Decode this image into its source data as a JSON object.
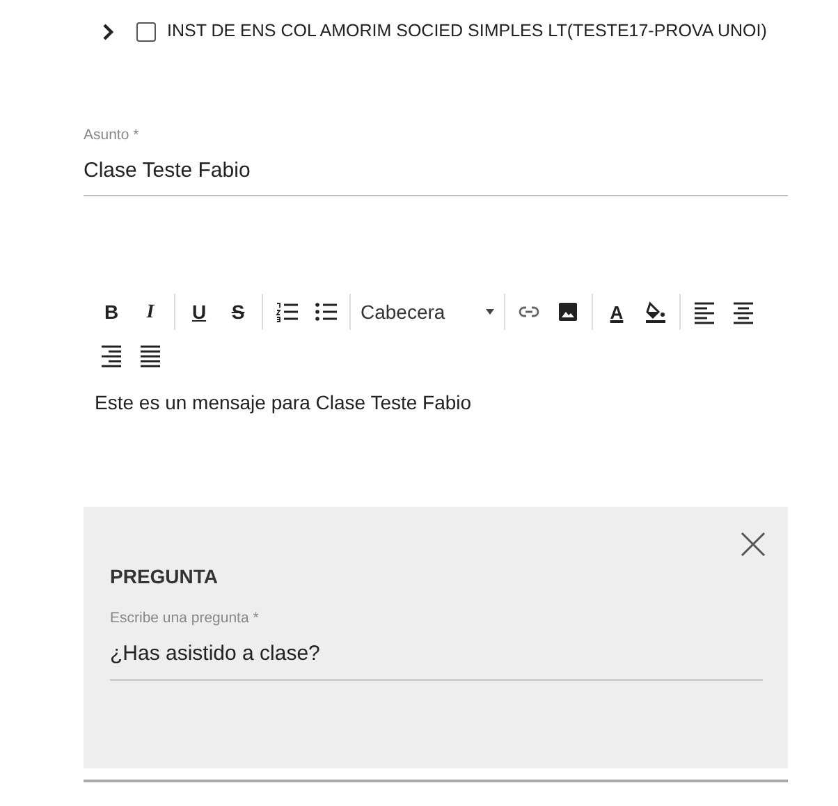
{
  "tree_item": {
    "label": "INST DE ENS COL AMORIM SOCIED SIMPLES LT(TESTE17-PROVA UNOI)",
    "expanded": false,
    "checked": false
  },
  "subject": {
    "label": "Asunto *",
    "value": "Clase Teste Fabio"
  },
  "toolbar": [
    [
      {
        "kind": "bold",
        "label": "B"
      },
      {
        "kind": "italic",
        "label": "I"
      }
    ],
    [
      {
        "kind": "underline",
        "label": "U"
      },
      {
        "kind": "strike",
        "label": "S"
      }
    ],
    [
      {
        "kind": "ordered-list"
      },
      {
        "kind": "bullet-list"
      }
    ],
    [
      {
        "kind": "select",
        "label": "Cabecera"
      }
    ],
    [
      {
        "kind": "link"
      },
      {
        "kind": "image"
      }
    ],
    [
      {
        "kind": "text-color",
        "label": "A"
      },
      {
        "kind": "fill-color"
      }
    ],
    [
      {
        "kind": "align-left"
      },
      {
        "kind": "align-center"
      },
      {
        "kind": "align-right"
      },
      {
        "kind": "justify"
      }
    ]
  ],
  "message": "Este es un mensaje para Clase Teste Fabio",
  "question_panel": {
    "title": "PREGUNTA",
    "field": {
      "label": "Escribe una pregunta *",
      "value": "¿Has asistido a clase?"
    }
  }
}
